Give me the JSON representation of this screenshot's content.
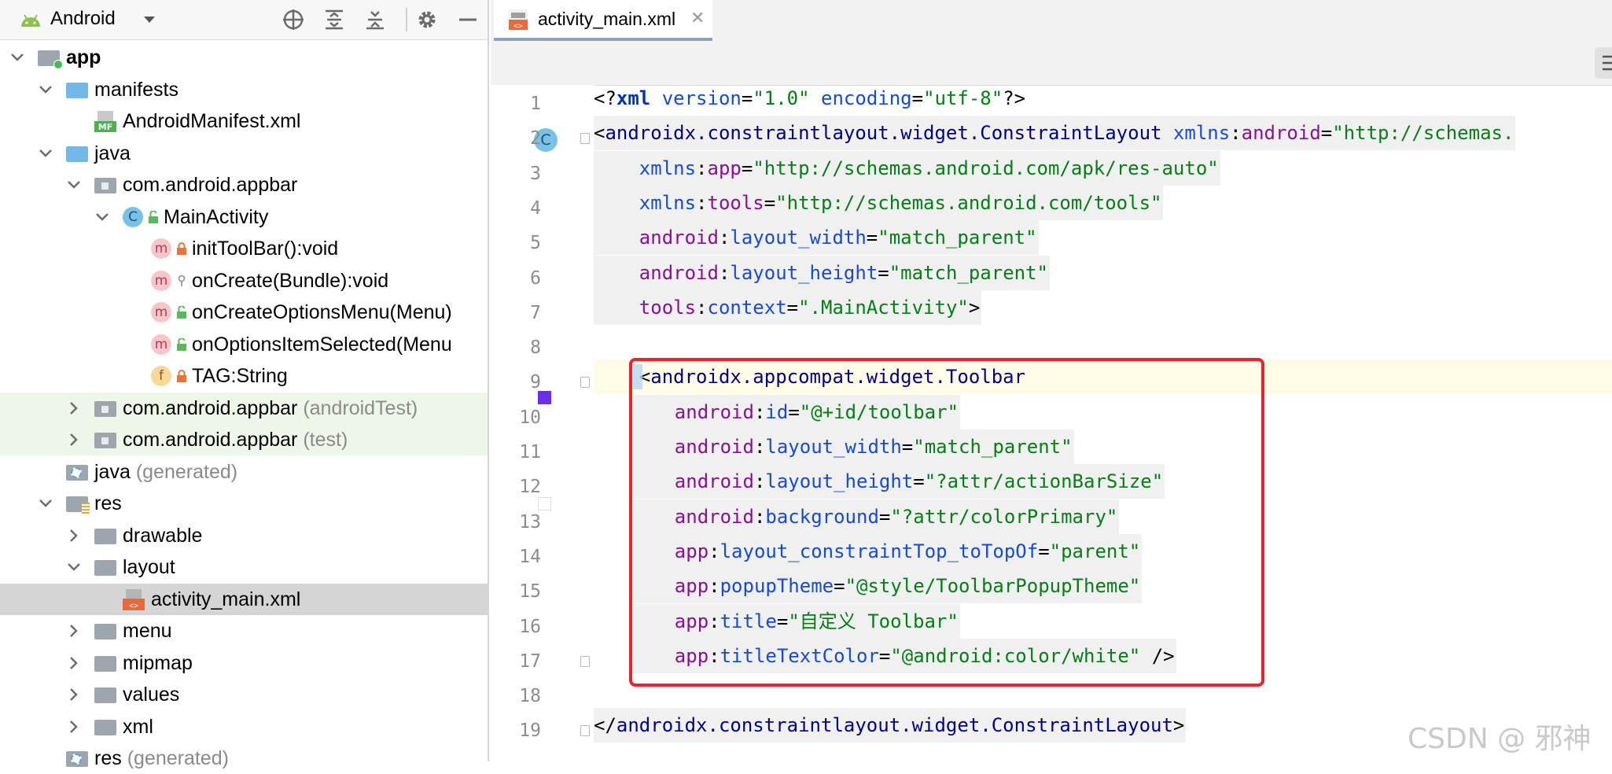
{
  "panel": {
    "title": "Android",
    "rows": [
      {
        "label": "app",
        "sub": "",
        "icon": "module-folder-icon"
      },
      {
        "label": "manifests",
        "sub": "",
        "icon": "folder-icon"
      },
      {
        "label": "AndroidManifest.xml",
        "sub": "",
        "icon": "manifest-file-icon",
        "icon_text": "MF"
      },
      {
        "label": "java",
        "sub": "",
        "icon": "folder-icon"
      },
      {
        "label": "com.android.appbar",
        "sub": "",
        "icon": "package-icon"
      },
      {
        "label": "MainActivity",
        "sub": "",
        "icon": "class-icon",
        "icon_text": "C"
      },
      {
        "label": "initToolBar():void",
        "sub": "",
        "icon": "method-icon",
        "icon_text": "m"
      },
      {
        "label": "onCreate(Bundle):void",
        "sub": "",
        "icon": "method-icon",
        "icon_text": "m"
      },
      {
        "label": "onCreateOptionsMenu(Menu)",
        "sub": "",
        "icon": "method-icon",
        "icon_text": "m"
      },
      {
        "label": "onOptionsItemSelected(Menu",
        "sub": "",
        "icon": "method-icon",
        "icon_text": "m"
      },
      {
        "label": "TAG:String",
        "sub": "",
        "icon": "field-icon",
        "icon_text": "f"
      },
      {
        "label": "com.android.appbar",
        "sub": "(androidTest)",
        "icon": "package-icon"
      },
      {
        "label": "com.android.appbar",
        "sub": "(test)",
        "icon": "package-icon"
      },
      {
        "label": "java",
        "sub": "(generated)",
        "icon": "generated-folder-icon"
      },
      {
        "label": "res",
        "sub": "",
        "icon": "resources-folder-icon"
      },
      {
        "label": "drawable",
        "sub": "",
        "icon": "folder-icon"
      },
      {
        "label": "layout",
        "sub": "",
        "icon": "folder-icon"
      },
      {
        "label": "activity_main.xml",
        "sub": "",
        "icon": "layout-xml-icon"
      },
      {
        "label": "menu",
        "sub": "",
        "icon": "folder-icon"
      },
      {
        "label": "mipmap",
        "sub": "",
        "icon": "folder-icon"
      },
      {
        "label": "values",
        "sub": "",
        "icon": "folder-icon"
      },
      {
        "label": "xml",
        "sub": "",
        "icon": "folder-icon"
      },
      {
        "label": "res",
        "sub": "(generated)",
        "icon": "generated-folder-icon"
      }
    ]
  },
  "editor": {
    "tab_label": "activity_main.xml",
    "gutter_badge": "C",
    "lines": [
      {
        "num": "1",
        "tokens": [
          [
            "pun",
            "<?"
          ],
          [
            "kw",
            "xml "
          ],
          [
            "attr",
            "version"
          ],
          [
            "pun",
            "="
          ],
          [
            "val",
            "\"1.0\""
          ],
          [
            "pun",
            " "
          ],
          [
            "attr",
            "encoding"
          ],
          [
            "pun",
            "="
          ],
          [
            "val",
            "\"utf-8\""
          ],
          [
            "pun",
            "?>"
          ]
        ]
      },
      {
        "num": "2",
        "tokens": [
          [
            "pun",
            "<"
          ],
          [
            "tag",
            "androidx.constraintlayout.widget.ConstraintLayout"
          ],
          [
            "pun",
            " "
          ],
          [
            "attr",
            "xmlns"
          ],
          [
            "pun",
            ":"
          ],
          [
            "ns",
            "android"
          ],
          [
            "pun",
            "="
          ],
          [
            "val",
            "\"http://schemas."
          ]
        ]
      },
      {
        "num": "3",
        "tokens": [
          [
            "pun",
            "    "
          ],
          [
            "attr",
            "xmlns"
          ],
          [
            "pun",
            ":"
          ],
          [
            "ns",
            "app"
          ],
          [
            "pun",
            "="
          ],
          [
            "val",
            "\"http://schemas.android.com/apk/res-auto\""
          ]
        ]
      },
      {
        "num": "4",
        "tokens": [
          [
            "pun",
            "    "
          ],
          [
            "attr",
            "xmlns"
          ],
          [
            "pun",
            ":"
          ],
          [
            "ns",
            "tools"
          ],
          [
            "pun",
            "="
          ],
          [
            "val",
            "\"http://schemas.android.com/tools\""
          ]
        ]
      },
      {
        "num": "5",
        "tokens": [
          [
            "pun",
            "    "
          ],
          [
            "ns",
            "android"
          ],
          [
            "pun",
            ":"
          ],
          [
            "attr",
            "layout_width"
          ],
          [
            "pun",
            "="
          ],
          [
            "val",
            "\"match_parent\""
          ]
        ]
      },
      {
        "num": "6",
        "tokens": [
          [
            "pun",
            "    "
          ],
          [
            "ns",
            "android"
          ],
          [
            "pun",
            ":"
          ],
          [
            "attr",
            "layout_height"
          ],
          [
            "pun",
            "="
          ],
          [
            "val",
            "\"match_parent\""
          ]
        ]
      },
      {
        "num": "7",
        "tokens": [
          [
            "pun",
            "    "
          ],
          [
            "ns",
            "tools"
          ],
          [
            "pun",
            ":"
          ],
          [
            "attr",
            "context"
          ],
          [
            "pun",
            "="
          ],
          [
            "val",
            "\".MainActivity\""
          ],
          [
            "pun",
            ">"
          ]
        ]
      },
      {
        "num": "8",
        "tokens": []
      },
      {
        "num": "9",
        "tokens": [
          [
            "pun",
            "    <"
          ],
          [
            "tag",
            "androidx.appcompat.widget.Toolbar"
          ]
        ]
      },
      {
        "num": "10",
        "tokens": [
          [
            "pun",
            "        "
          ],
          [
            "ns",
            "android"
          ],
          [
            "pun",
            ":"
          ],
          [
            "attr",
            "id"
          ],
          [
            "pun",
            "="
          ],
          [
            "val",
            "\"@+id/toolbar\""
          ]
        ]
      },
      {
        "num": "11",
        "tokens": [
          [
            "pun",
            "        "
          ],
          [
            "ns",
            "android"
          ],
          [
            "pun",
            ":"
          ],
          [
            "attr",
            "layout_width"
          ],
          [
            "pun",
            "="
          ],
          [
            "val",
            "\"match_parent\""
          ]
        ]
      },
      {
        "num": "12",
        "tokens": [
          [
            "pun",
            "        "
          ],
          [
            "ns",
            "android"
          ],
          [
            "pun",
            ":"
          ],
          [
            "attr",
            "layout_height"
          ],
          [
            "pun",
            "="
          ],
          [
            "val",
            "\"?attr/actionBarSize\""
          ]
        ]
      },
      {
        "num": "13",
        "tokens": [
          [
            "pun",
            "        "
          ],
          [
            "ns",
            "android"
          ],
          [
            "pun",
            ":"
          ],
          [
            "attr",
            "background"
          ],
          [
            "pun",
            "="
          ],
          [
            "val",
            "\"?attr/colorPrimary\""
          ]
        ]
      },
      {
        "num": "14",
        "tokens": [
          [
            "pun",
            "        "
          ],
          [
            "ns",
            "app"
          ],
          [
            "pun",
            ":"
          ],
          [
            "attr",
            "layout_constraintTop_toTopOf"
          ],
          [
            "pun",
            "="
          ],
          [
            "val",
            "\"parent\""
          ]
        ]
      },
      {
        "num": "15",
        "tokens": [
          [
            "pun",
            "        "
          ],
          [
            "ns",
            "app"
          ],
          [
            "pun",
            ":"
          ],
          [
            "attr",
            "popupTheme"
          ],
          [
            "pun",
            "="
          ],
          [
            "val",
            "\"@style/ToolbarPopupTheme\""
          ]
        ]
      },
      {
        "num": "16",
        "tokens": [
          [
            "pun",
            "        "
          ],
          [
            "ns",
            "app"
          ],
          [
            "pun",
            ":"
          ],
          [
            "attr",
            "title"
          ],
          [
            "pun",
            "="
          ],
          [
            "val",
            "\"自定义 Toolbar\""
          ]
        ]
      },
      {
        "num": "17",
        "tokens": [
          [
            "pun",
            "        "
          ],
          [
            "ns",
            "app"
          ],
          [
            "pun",
            ":"
          ],
          [
            "attr",
            "titleTextColor"
          ],
          [
            "pun",
            "="
          ],
          [
            "val",
            "\"@android:color/white\""
          ],
          [
            "pun",
            " />"
          ]
        ]
      },
      {
        "num": "18",
        "tokens": []
      },
      {
        "num": "19",
        "tokens": [
          [
            "pun",
            "</"
          ],
          [
            "tag",
            "androidx.constraintlayout.widget.ConstraintLayout"
          ],
          [
            "pun",
            ">"
          ]
        ]
      }
    ]
  },
  "watermark": "CSDN @ 邪神",
  "colors": {
    "highlight": "#e8232a",
    "color_primary_swatch": "#6a2ee8",
    "white_swatch": "#ffffff"
  }
}
